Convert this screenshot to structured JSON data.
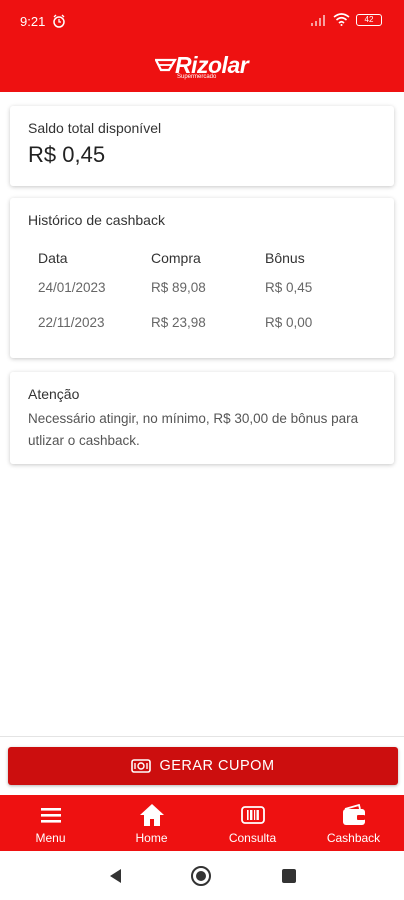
{
  "status_bar": {
    "time": "9:21",
    "battery": "42"
  },
  "header": {
    "logo_text": "Rizolar",
    "logo_sub": "Supermercado"
  },
  "saldo": {
    "label": "Saldo total disponível",
    "value": "R$ 0,45"
  },
  "historico": {
    "title": "Histórico de cashback",
    "columns": [
      "Data",
      "Compra",
      "Bônus"
    ],
    "rows": [
      {
        "data": "24/01/2023",
        "compra": "R$ 89,08",
        "bonus": "R$ 0,45"
      },
      {
        "data": "22/11/2023",
        "compra": "R$ 23,98",
        "bonus": "R$ 0,00"
      }
    ]
  },
  "atencao": {
    "title": "Atenção",
    "text": "Necessário atingir, no mínimo, R$ 30,00 de bônus para utlizar o cashback."
  },
  "action": {
    "label": "GERAR CUPOM",
    "icon": "coupon-icon"
  },
  "bottom_nav": [
    {
      "label": "Menu",
      "icon": "menu-icon"
    },
    {
      "label": "Home",
      "icon": "home-icon"
    },
    {
      "label": "Consulta",
      "icon": "barcode-icon"
    },
    {
      "label": "Cashback",
      "icon": "wallet-icon"
    }
  ],
  "colors": {
    "brand": "#ee1111",
    "button": "#cc0e0e"
  }
}
